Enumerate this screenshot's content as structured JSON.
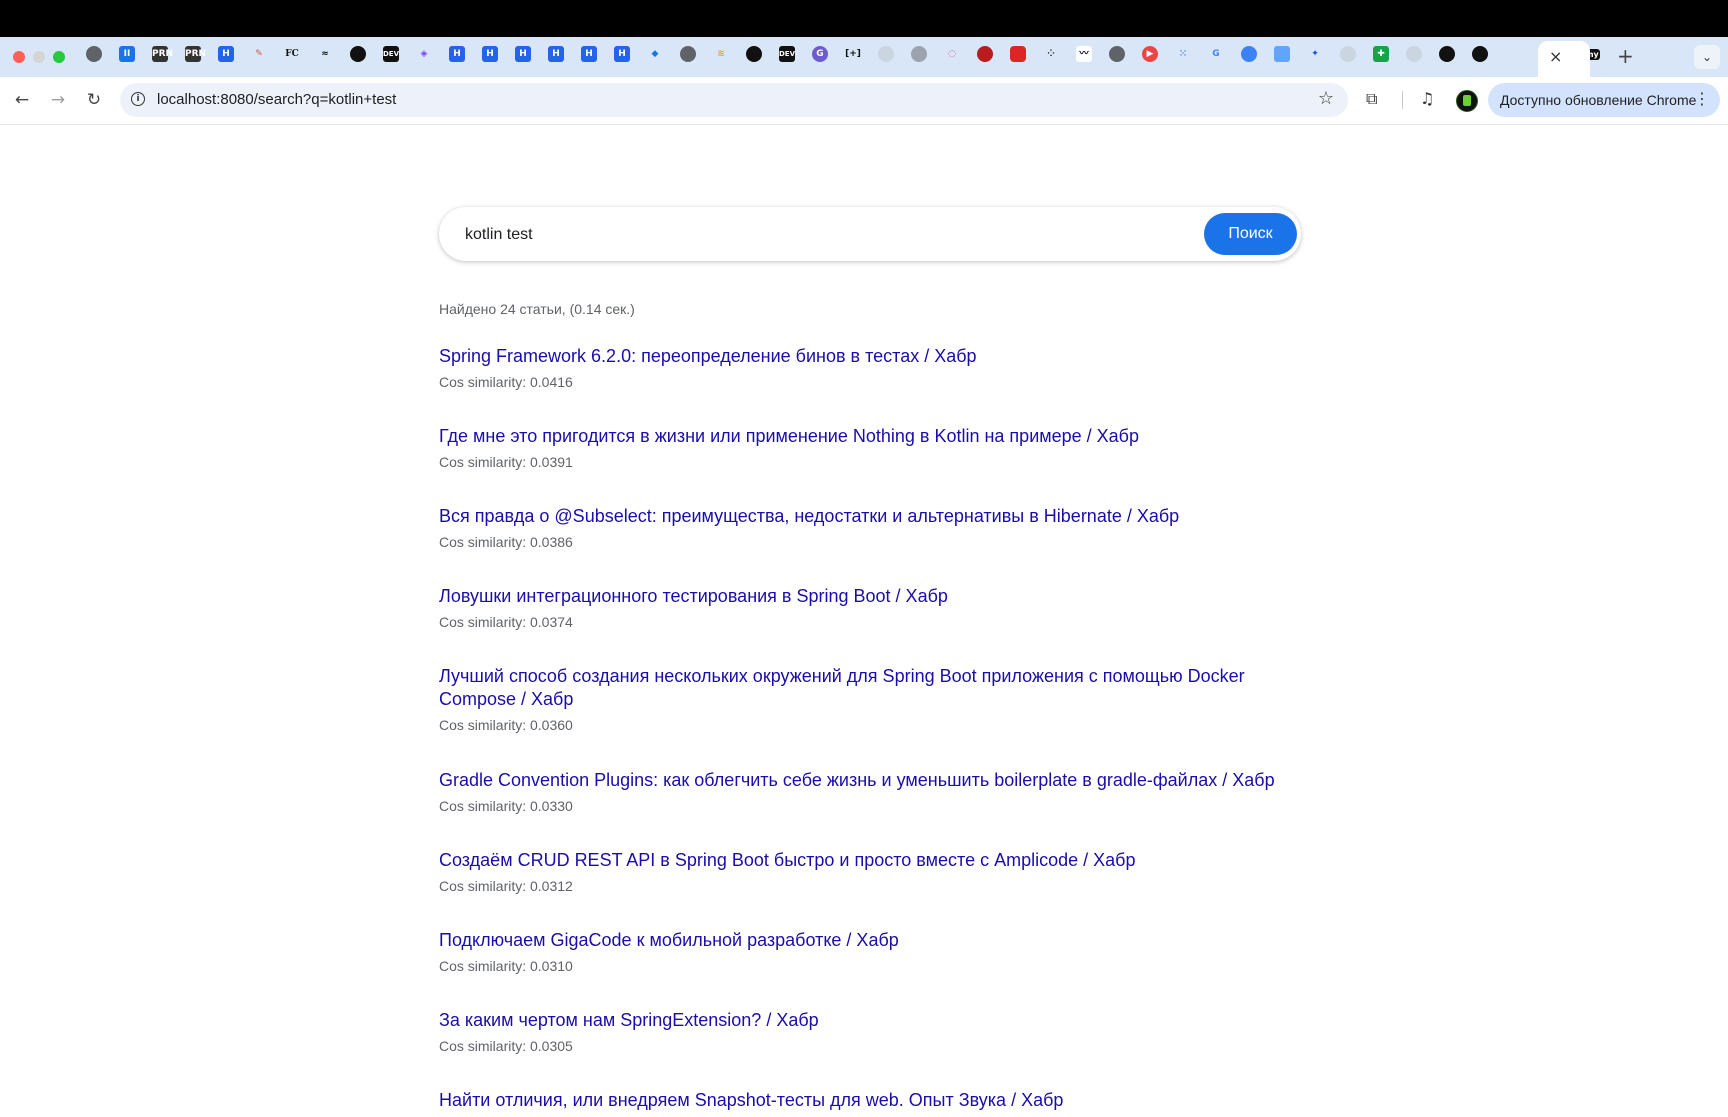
{
  "browser": {
    "tab_close_glyph": "×",
    "new_tab_glyph": "+",
    "tab_menu_glyph": "⌄",
    "address": "localhost:8080/search?q=kotlin+test",
    "update_button": "Доступно обновление Chrome",
    "favicon_texts": {
      "prn": "PRN",
      "fc": "FC",
      "dev": "DEV",
      "h": "H",
      "my": "my"
    }
  },
  "search": {
    "query": "kotlin test",
    "button": "Поиск"
  },
  "stats": "Найдено 24 статьи, (0.14 сек.)",
  "results": [
    {
      "title": "Spring Framework 6.2.0: переопределение бинов в тестах / Хабр",
      "score": "Cos similarity: 0.0416"
    },
    {
      "title": "Где мне это пригодится в жизни или применение Nothing в Kotlin на примере / Хабр",
      "score": "Cos similarity: 0.0391"
    },
    {
      "title": "Вся правда о @Subselect: преимущества, недостатки и альтернативы в Hibernate / Хабр",
      "score": "Cos similarity: 0.0386"
    },
    {
      "title": "Ловушки интеграционного тестирования в Spring Boot / Хабр",
      "score": "Cos similarity: 0.0374"
    },
    {
      "title": "Лучший способ создания нескольких окружений для Spring Boot приложения с помощью Docker Compose / Хабр",
      "score": "Cos similarity: 0.0360"
    },
    {
      "title": "Gradle Convention Plugins: как облегчить себе жизнь и уменьшить boilerplate в gradle-файлах / Хабр",
      "score": "Cos similarity: 0.0330"
    },
    {
      "title": "Создаём CRUD REST API в Spring Boot быстро и просто вместе с Amplicode / Хабр",
      "score": "Cos similarity: 0.0312"
    },
    {
      "title": "Подключаем GigaCode к мобильной разработке / Хабр",
      "score": "Cos similarity: 0.0310"
    },
    {
      "title": "За каким чертом нам SpringExtension? / Хабр",
      "score": "Cos similarity: 0.0305"
    },
    {
      "title": "Найти отличия, или внедряем Snapshot-тесты для web. Опыт Звука / Хабр",
      "score": ""
    }
  ]
}
